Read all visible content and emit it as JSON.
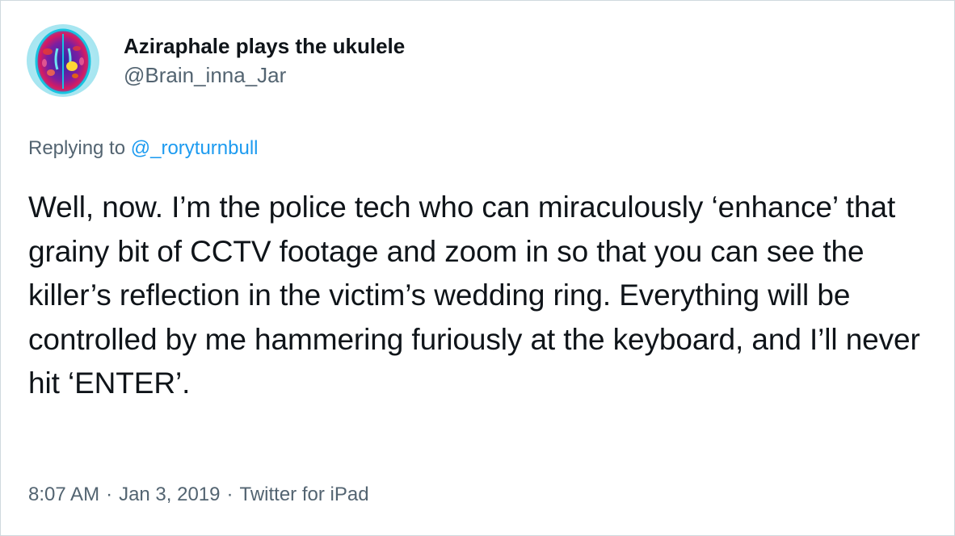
{
  "author": {
    "display_name": "Aziraphale plays the ukulele",
    "handle": "@Brain_inna_Jar",
    "avatar_icon": "brain-scan-avatar"
  },
  "reply": {
    "prefix": "Replying to",
    "mention": "@_roryturnbull"
  },
  "tweet": {
    "text": "Well, now. I’m the police tech who can miraculously ‘enhance’ that grainy bit of CCTV footage and zoom in so that you can see the killer’s reflection in the victim’s wedding ring. Everything will be controlled by me hammering furiously at the keyboard, and I’ll never hit ‘ENTER’."
  },
  "meta": {
    "time": "8:07 AM",
    "separator": "·",
    "date": "Jan 3, 2019",
    "source": "Twitter for iPad"
  },
  "colors": {
    "text_primary": "#0f1419",
    "text_secondary": "#536471",
    "link": "#1d9bf0",
    "border": "#cfd9de"
  }
}
